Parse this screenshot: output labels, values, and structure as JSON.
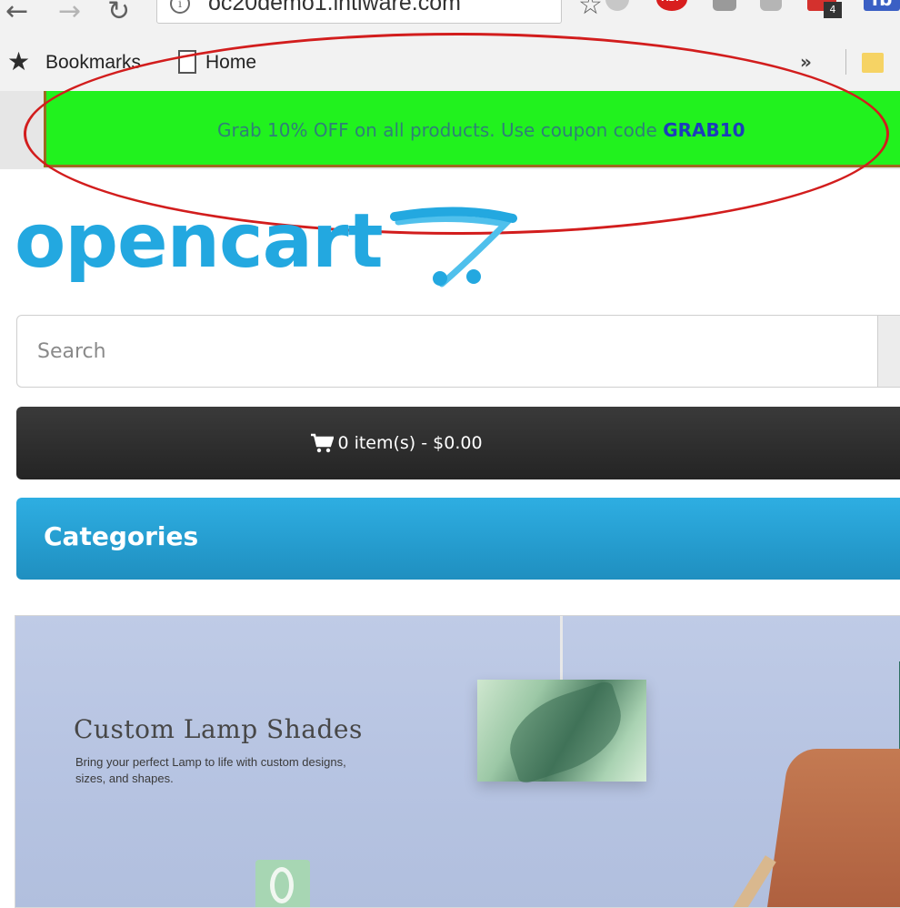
{
  "browser": {
    "url": "oc20demo1.intiware.com",
    "bookmarks": [
      {
        "label": "Bookmarks"
      },
      {
        "label": "Home"
      }
    ],
    "more_label": "»",
    "extensions": [
      {
        "icon": "gray-extension-icon"
      },
      {
        "icon": "adblock-icon",
        "label": "ABP"
      },
      {
        "icon": "box-extension-icon"
      },
      {
        "icon": "puzzle-extension-icon"
      },
      {
        "icon": "red-extension-icon",
        "badge": "4"
      },
      {
        "icon": "fb-extension-icon",
        "label": "fb"
      }
    ]
  },
  "promo": {
    "text": "Grab 10% OFF on all products. Use coupon code ",
    "code": "GRAB10",
    "bar_color": "#21f21e",
    "annotation_color": "#d21d1d"
  },
  "logo": {
    "text": "opencart"
  },
  "search": {
    "placeholder": "Search"
  },
  "cart": {
    "label": "0 item(s) - $0.00"
  },
  "categories": {
    "title": "Categories"
  },
  "banner": {
    "heading": "Custom Lamp Shades",
    "subtext": "Bring your perfect Lamp to life with custom designs, sizes, and shapes."
  },
  "colors": {
    "brand_blue": "#23a8e0",
    "cart_bg": "#2c2c2c",
    "categories_bg": "#2aa4d8"
  }
}
